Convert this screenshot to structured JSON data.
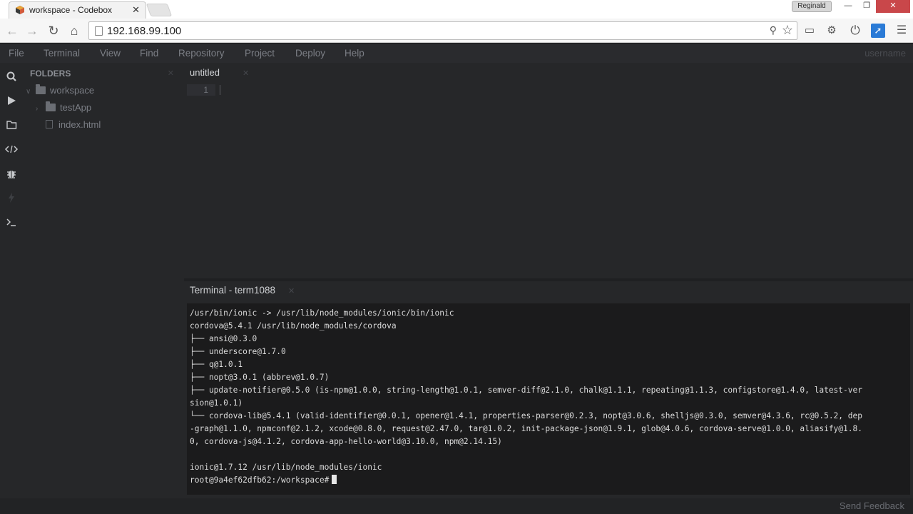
{
  "browser": {
    "tab_title": "workspace - Codebox",
    "tab_close": "✕",
    "profile_name": "Reginald",
    "window_controls": {
      "minimize": "—",
      "maximize": "❐",
      "close": "✕"
    },
    "url": "192.168.99.100",
    "icons": {
      "back": "back-arrow-icon",
      "forward": "forward-arrow-icon",
      "reload": "reload-icon",
      "home": "home-icon",
      "key": "key-icon",
      "star": "bookmark-star-icon",
      "cast": "cast-icon",
      "extension": "extension-gear-icon",
      "power": "power-icon",
      "blue_ext": "blue-extension-icon",
      "menu": "hamburger-menu-icon"
    }
  },
  "app": {
    "menu": [
      "File",
      "Terminal",
      "View",
      "Find",
      "Repository",
      "Project",
      "Deploy",
      "Help"
    ],
    "username": "username",
    "sidebar": {
      "header": "FOLDERS",
      "tree": [
        {
          "label": "workspace",
          "type": "folder",
          "depth": 0,
          "expanded": true
        },
        {
          "label": "testApp",
          "type": "folder",
          "depth": 1,
          "expanded": false
        },
        {
          "label": "index.html",
          "type": "file",
          "depth": 1
        }
      ]
    },
    "editor": {
      "tab_label": "untitled",
      "line_number": "1"
    },
    "terminal": {
      "tab_label": "Terminal - term1088",
      "lines": [
        "/usr/bin/ionic -> /usr/lib/node_modules/ionic/bin/ionic",
        "cordova@5.4.1 /usr/lib/node_modules/cordova",
        "├── ansi@0.3.0",
        "├── underscore@1.7.0",
        "├── q@1.0.1",
        "├── nopt@3.0.1 (abbrev@1.0.7)",
        "├── update-notifier@0.5.0 (is-npm@1.0.0, string-length@1.0.1, semver-diff@2.1.0, chalk@1.1.1, repeating@1.1.3, configstore@1.4.0, latest-ver",
        "sion@1.0.1)",
        "└── cordova-lib@5.4.1 (valid-identifier@0.0.1, opener@1.4.1, properties-parser@0.2.3, nopt@3.0.6, shelljs@0.3.0, semver@4.3.6, rc@0.5.2, dep",
        "-graph@1.1.0, npmconf@2.1.2, xcode@0.8.0, request@2.47.0, tar@1.0.2, init-package-json@1.9.1, glob@4.0.6, cordova-serve@1.0.0, aliasify@1.8.",
        "0, cordova-js@4.1.2, cordova-app-hello-world@3.10.0, npm@2.14.15)",
        "",
        "ionic@1.7.12 /usr/lib/node_modules/ionic"
      ],
      "prompt": "root@9a4ef62dfb62:/workspace#"
    },
    "status": {
      "feedback": "Send Feedback"
    }
  },
  "colors": {
    "app_bg": "#262729",
    "menubar_bg": "#2a2b2e",
    "terminal_bg": "#1b1b1c",
    "browser_close": "#c9474a",
    "ext_blue": "#2b7bd6"
  }
}
